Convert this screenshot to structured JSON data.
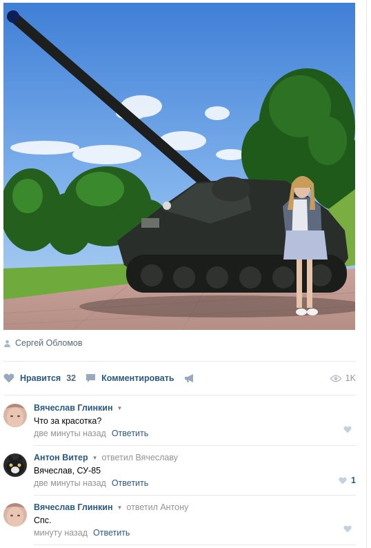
{
  "post": {
    "author": "Сергей Обломов",
    "likes_label": "Нравится",
    "likes_count": "32",
    "comment_label": "Комментировать",
    "views": "1K"
  },
  "comments": [
    {
      "author": "Вячеслав Глинкин",
      "more": "▼",
      "reply_to": "",
      "text": "Что за красотка?",
      "date": "две минуты назад",
      "reply_label": "Ответить",
      "likes": ""
    },
    {
      "author": "Антон Витер",
      "more": "▼",
      "reply_to": "ответил Вячеславу",
      "text": "Вячеслав, СУ-85",
      "date": "две минуты назад",
      "reply_label": "Ответить",
      "likes": "1"
    },
    {
      "author": "Вячеслав Глинкин",
      "more": "▼",
      "reply_to": "ответил Антону",
      "text": "Спс.",
      "date": "минуту назад",
      "reply_label": "Ответить",
      "likes": ""
    }
  ],
  "colors": {
    "link": "#2a5885",
    "meta": "#939393",
    "divider": "#e7e8ec"
  },
  "icons": [
    "user-icon",
    "heart-icon",
    "comment-icon",
    "share-icon",
    "eye-icon"
  ]
}
